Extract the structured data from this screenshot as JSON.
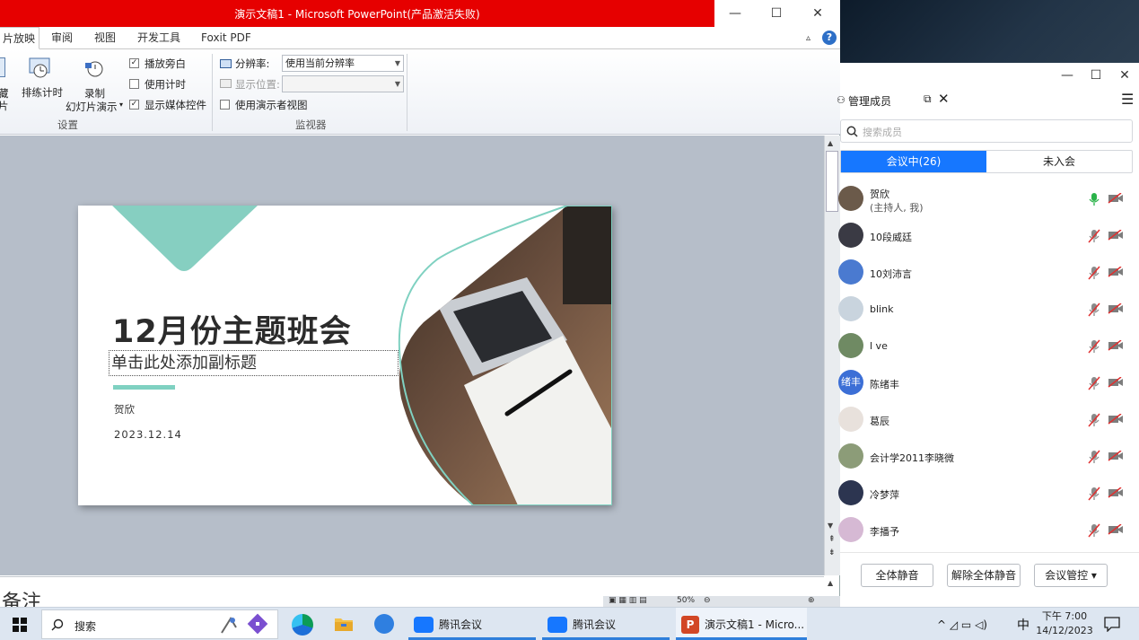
{
  "ppt": {
    "title": "演示文稿1 - Microsoft PowerPoint(产品激活失败)",
    "win_min": "—",
    "win_max": "☐",
    "win_close": "✕",
    "tabs": [
      {
        "label": "片放映",
        "active": true
      },
      {
        "label": "审阅"
      },
      {
        "label": "视图"
      },
      {
        "label": "开发工具"
      },
      {
        "label": "Foxit PDF"
      }
    ],
    "ribbon": {
      "left_cut_1": "藏",
      "left_cut_2": "片",
      "rehearse": "排练计时",
      "record_1": "录制",
      "record_2": "幻灯片演示",
      "record_arrow": "▾",
      "play_narration": "播放旁白",
      "use_timings": "使用计时",
      "show_media_controls": "显示媒体控件",
      "setup_group": "设置",
      "resolution_label": "分辨率:",
      "resolution_value": "使用当前分辨率",
      "show_on_label": "显示位置:",
      "show_on_value": "",
      "presenter_view": "使用演示者视图",
      "monitor_group": "监视器",
      "play_narration_checked": true,
      "use_timings_checked": false,
      "show_media_checked": true,
      "presenter_view_checked": false,
      "checkmark": "✓"
    },
    "slide": {
      "title": "12月份主题班会",
      "subtitle": "单击此处添加副标题",
      "author": "贺欣",
      "date": "2023.12.14",
      "accent": "#7fd1c1"
    },
    "notes_partial": "备注",
    "zoom": "50%"
  },
  "meeting": {
    "win_min": "—",
    "win_max": "☐",
    "win_close": "✕",
    "panel_title": "管理成员",
    "search_placeholder": "搜索成员",
    "tab_in": "会议中(26)",
    "tab_out": "未入会",
    "members": [
      {
        "name": "贺欣",
        "sub": "(主持人, 我)",
        "mic_on": true,
        "avatar_color": "#6b5a4a"
      },
      {
        "name": "10段威廷",
        "avatar_color": "#3a3a44"
      },
      {
        "name": "10刘沛言",
        "avatar_color": "#4a7ad0"
      },
      {
        "name": "blink",
        "avatar_color": "#c9d4de"
      },
      {
        "name": "l ve",
        "avatar_color": "#6f8a63"
      },
      {
        "name": "陈绪丰",
        "avatar_text": "绪丰",
        "avatar_color": "#3c6fd6"
      },
      {
        "name": "葛辰",
        "avatar_color": "#e8e1dc"
      },
      {
        "name": "会计学2011李晓微",
        "avatar_color": "#8c9c78"
      },
      {
        "name": "冷梦萍",
        "avatar_color": "#2c3550"
      },
      {
        "name": "李播予",
        "avatar_color": "#d6b9d4"
      }
    ],
    "mute_all": "全体静音",
    "unmute_all": "解除全体静音",
    "meeting_control": "会议管控 ▾",
    "accent": "#1677ff"
  },
  "taskbar": {
    "search": "搜索",
    "apps": [
      {
        "label": "腾讯会议"
      },
      {
        "label": "腾讯会议"
      },
      {
        "label": "演示文稿1 - Micro..."
      }
    ],
    "ime": "中",
    "time": "下午 7:00",
    "date": "14/12/2023",
    "tray": "^ ◿ ▭ ◁)"
  }
}
